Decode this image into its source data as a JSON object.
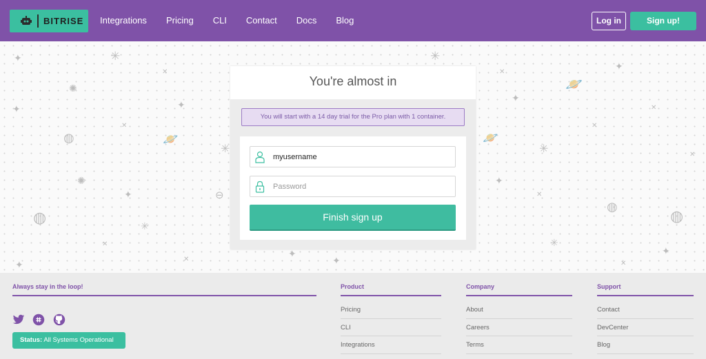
{
  "nav": {
    "brand": "BITRISE",
    "links": [
      "Integrations",
      "Pricing",
      "CLI",
      "Contact",
      "Docs",
      "Blog"
    ],
    "login": "Log in",
    "signup": "Sign up!"
  },
  "card": {
    "title": "You're almost in",
    "notice": "You will start with a 14 day trial for the Pro plan with 1 container.",
    "username_value": "myusername",
    "password_placeholder": "Password",
    "finish_button": "Finish sign up"
  },
  "footer": {
    "loop_heading": "Always stay in the loop!",
    "status_label": "Status:",
    "status_value": "All Systems Operational",
    "columns": [
      {
        "heading": "Product",
        "links": [
          "Pricing",
          "CLI",
          "Integrations"
        ]
      },
      {
        "heading": "Company",
        "links": [
          "About",
          "Careers",
          "Terms"
        ]
      },
      {
        "heading": "Support",
        "links": [
          "Contact",
          "DevCenter",
          "Blog"
        ]
      }
    ]
  },
  "colors": {
    "purple": "#7f52a8",
    "teal": "#3bbfa0"
  },
  "icons": [
    "robot-logo-icon",
    "user-icon",
    "lock-icon",
    "twitter-icon",
    "slack-icon",
    "github-icon"
  ]
}
